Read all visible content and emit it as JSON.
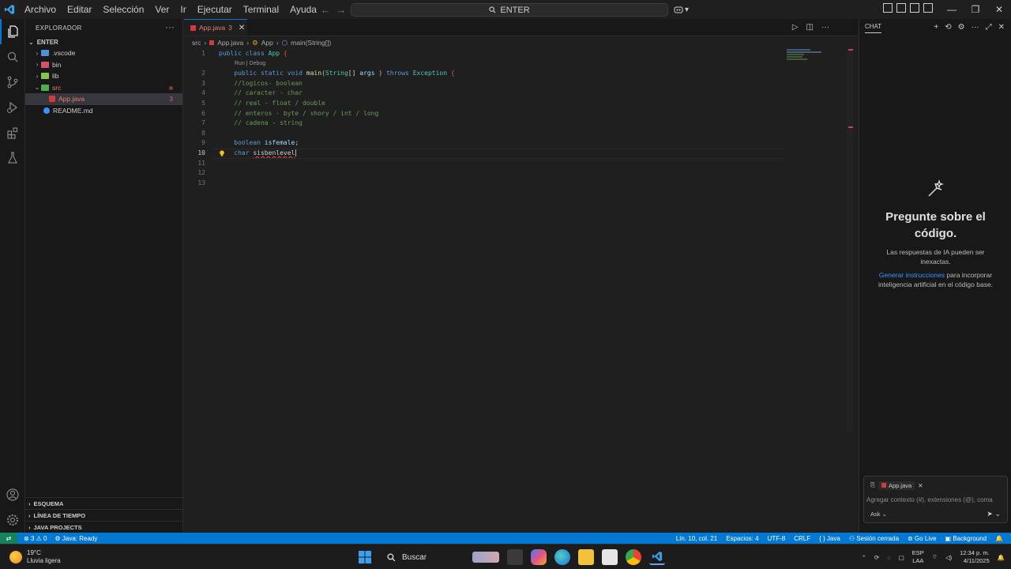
{
  "titlebar": {
    "menu": [
      "Archivo",
      "Editar",
      "Selección",
      "Ver",
      "Ir",
      "Ejecutar",
      "Terminal",
      "Ayuda"
    ],
    "search_text": "ENTER"
  },
  "sidebar": {
    "title": "EXPLORADOR",
    "root": "ENTER",
    "items": [
      {
        "label": ".vscode",
        "type": "folder",
        "badge": ""
      },
      {
        "label": "bin",
        "type": "folder",
        "badge": ""
      },
      {
        "label": "lib",
        "type": "folder",
        "badge": ""
      },
      {
        "label": "src",
        "type": "folder-open",
        "badge": ""
      },
      {
        "label": "App.java",
        "type": "java",
        "badge": "3"
      },
      {
        "label": "README.md",
        "type": "info",
        "badge": ""
      }
    ],
    "sections": [
      "ESQUEMA",
      "LÍNEA DE TIEMPO",
      "JAVA PROJECTS"
    ]
  },
  "editor": {
    "tab_label": "App.java",
    "tab_badge": "3",
    "breadcrumb": [
      "src",
      "App.java",
      "App",
      "main(String[])"
    ],
    "codelens": "Run | Debug",
    "lines": [
      {
        "n": "1",
        "tokens": [
          [
            "kw",
            "public "
          ],
          [
            "kw",
            "class "
          ],
          [
            "ty",
            "App "
          ],
          [
            "br",
            "{"
          ]
        ]
      },
      {
        "n": "2",
        "tokens": [
          [
            "",
            "    "
          ],
          [
            "kw",
            "public "
          ],
          [
            "kw",
            "static "
          ],
          [
            "kw",
            "void "
          ],
          [
            "fn",
            "main"
          ],
          [
            "",
            "("
          ],
          [
            "ty",
            "String"
          ],
          [
            "",
            "[] "
          ],
          [
            "va",
            "args"
          ],
          [
            "",
            " ) "
          ],
          [
            "kw",
            "throws "
          ],
          [
            "ty",
            "Exception "
          ],
          [
            "br",
            "{"
          ]
        ]
      },
      {
        "n": "3",
        "tokens": [
          [
            "",
            "    "
          ],
          [
            "cm",
            "//logicos- boolean"
          ]
        ]
      },
      {
        "n": "4",
        "tokens": [
          [
            "",
            "    "
          ],
          [
            "cm",
            "// caracter - char"
          ]
        ]
      },
      {
        "n": "5",
        "tokens": [
          [
            "",
            "    "
          ],
          [
            "cm",
            "// real - float / double"
          ]
        ]
      },
      {
        "n": "6",
        "tokens": [
          [
            "",
            "    "
          ],
          [
            "cm",
            "// enteros - byte / shory / int / long"
          ]
        ]
      },
      {
        "n": "7",
        "tokens": [
          [
            "",
            "    "
          ],
          [
            "cm",
            "// cadena - string"
          ]
        ]
      },
      {
        "n": "8",
        "tokens": []
      },
      {
        "n": "9",
        "tokens": [
          [
            "",
            "    "
          ],
          [
            "kw",
            "boolean "
          ],
          [
            "va",
            "isfemale"
          ],
          [
            "",
            ";"
          ]
        ]
      },
      {
        "n": "10",
        "tokens": [
          [
            "",
            "    "
          ],
          [
            "kw",
            "char "
          ],
          [
            "err",
            "sisbenlevel"
          ]
        ]
      },
      {
        "n": "11",
        "tokens": []
      },
      {
        "n": "12",
        "tokens": []
      },
      {
        "n": "13",
        "tokens": []
      }
    ]
  },
  "chat": {
    "header": "CHAT",
    "title": "Pregunte sobre el código.",
    "subtitle": "Las respuestas de IA pueden ser inexactas.",
    "link": "Generar instrucciones",
    "link_rest": " para incorporar inteligencia artificial en el código base.",
    "attached_file": "App.java",
    "input_placeholder": "Agregar contexto (#), extensiones (@), coma",
    "mode": "Ask"
  },
  "statusbar": {
    "problems": "3",
    "warnings": "0",
    "java_status": "Java: Ready",
    "position": "Lín. 10, col. 21",
    "spaces": "Espacios: 4",
    "encoding": "UTF-8",
    "eol": "CRLF",
    "language": "Java",
    "session": "Sesión cerrada",
    "golive": "Go Live",
    "background": "Background"
  },
  "taskbar": {
    "temp": "19°C",
    "weather": "Lluvia ligera",
    "search": "Buscar",
    "lang1": "ESP",
    "lang2": "LAA",
    "time": "12:34 p. m.",
    "date": "4/11/2025"
  },
  "colors": {
    "accent": "#0078d4",
    "keyword": "#569cd6",
    "comment": "#6a9955",
    "type": "#4ec9b0",
    "error": "#f14c4c"
  }
}
